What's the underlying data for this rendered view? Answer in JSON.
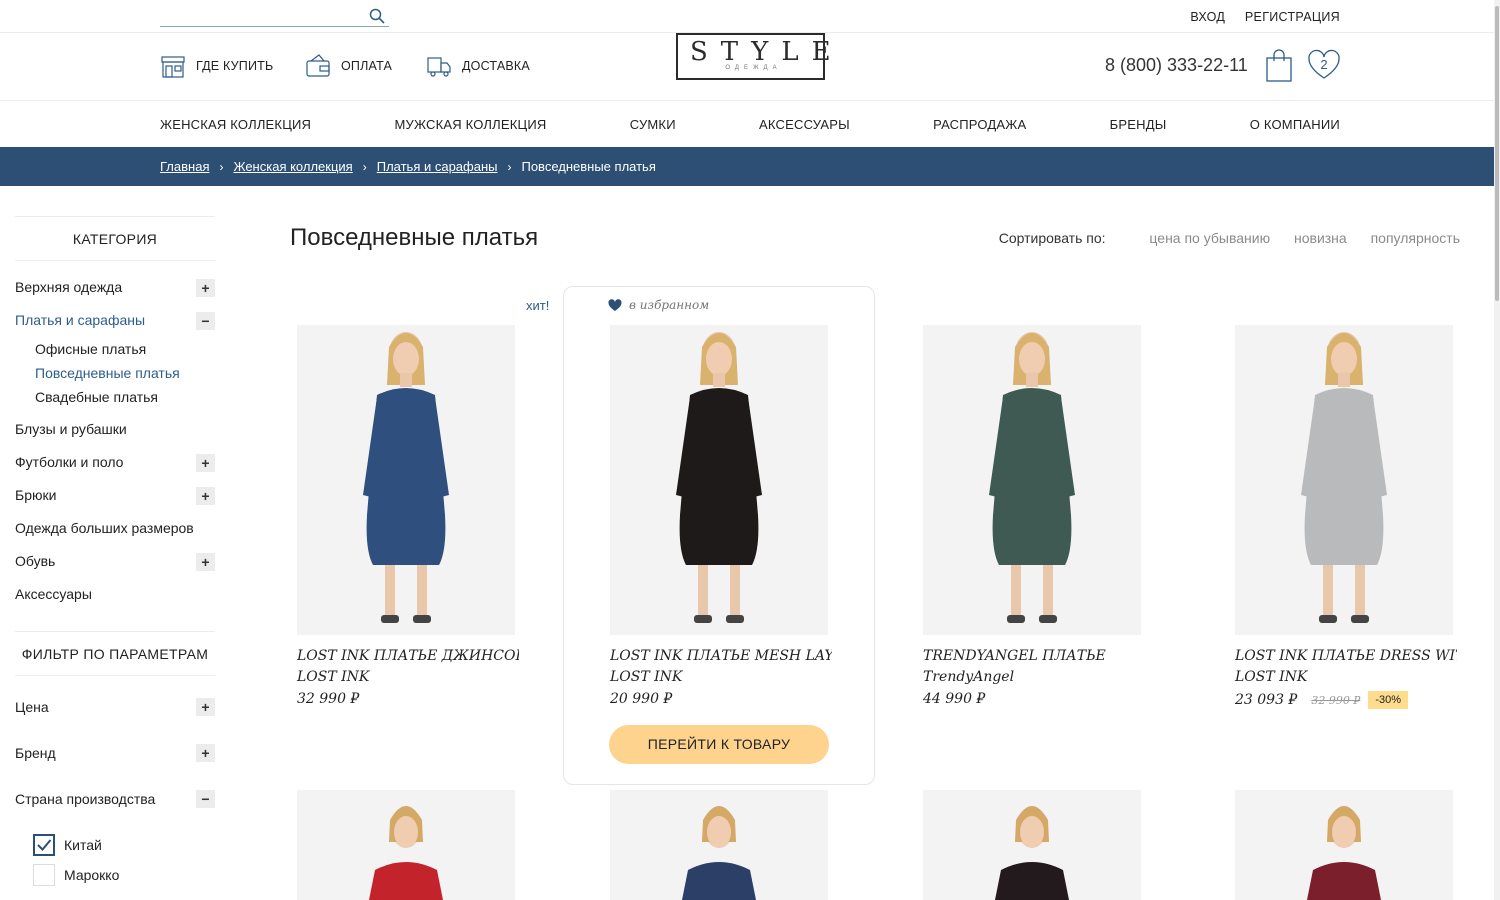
{
  "topbar": {
    "search_placeholder": "",
    "login": "ВХОД",
    "register": "РЕГИСТРАЦИЯ"
  },
  "header": {
    "links": [
      "ГДЕ КУПИТЬ",
      "ОПЛАТА",
      "ДОСТАВКА"
    ],
    "logo": "STYLE",
    "logo_sub": "ОДЕЖДА",
    "phone": "8 (800) 333-22-11",
    "fav_count": "2"
  },
  "nav": [
    "ЖЕНСКАЯ КОЛЛЕКЦИЯ",
    "МУЖСКАЯ КОЛЛЕКЦИЯ",
    "СУМКИ",
    "АКСЕССУАРЫ",
    "РАСПРОДАЖА",
    "БРЕНДЫ",
    "О КОМПАНИИ"
  ],
  "breadcrumb": [
    "Главная",
    "Женская коллекция",
    "Платья и сарафаны",
    "Повседневные платья"
  ],
  "sidebar": {
    "category_title": "КАТЕГОРИЯ",
    "categories": {
      "outerwear": "Верхняя одежда",
      "dresses": "Платья и сарафаны",
      "sub_office": "Офисные платья",
      "sub_casual": "Повседневные платья",
      "sub_wedding": "Свадебные платья",
      "blouses": "Блузы и рубашки",
      "tshirts": "Футболки и поло",
      "trousers": "Брюки",
      "plus": "Одежда больших размеров",
      "shoes": "Обувь",
      "accessories": "Аксессуары"
    },
    "filter_title": "ФИЛЬТР ПО ПАРАМЕТРАМ",
    "filters": {
      "price": "Цена",
      "brand": "Бренд",
      "country": "Страна производства"
    },
    "countries": [
      "Китай",
      "Марокко"
    ]
  },
  "main": {
    "title": "Повседневные платья",
    "sort_label": "Сортировать по:",
    "sort_options": [
      "цена по убыванию",
      "новизна",
      "популярность"
    ],
    "hit": "хит!",
    "fav_note": "в избранном",
    "button": "ПЕРЕЙТИ К ТОВАРУ"
  },
  "products": [
    {
      "name": "LOST INK ПЛАТЬЕ ДЖИНСОВ...",
      "brand": "LOST INK",
      "price": "32 990  ₽",
      "color": "#2f4f7f"
    },
    {
      "name": "LOST INK ПЛАТЬЕ MESH LAY...",
      "brand": "LOST INK",
      "price": "20 990  ₽",
      "color": "#1f1a1a"
    },
    {
      "name": "TRENDYANGEL ПЛАТЬЕ",
      "brand": "TrendyAngel",
      "price": "44 990  ₽",
      "color": "#3e5a52"
    },
    {
      "name": "LOST INK ПЛАТЬЕ DRESS WIT...",
      "brand": "LOST INK",
      "price": "23 093  ₽",
      "old_price": "32 990  ₽",
      "discount": "-30%",
      "color": "#b9babc"
    }
  ],
  "row2_colors": [
    "#c3242c",
    "#2c3f66",
    "#221a1d",
    "#7a1f2b"
  ]
}
